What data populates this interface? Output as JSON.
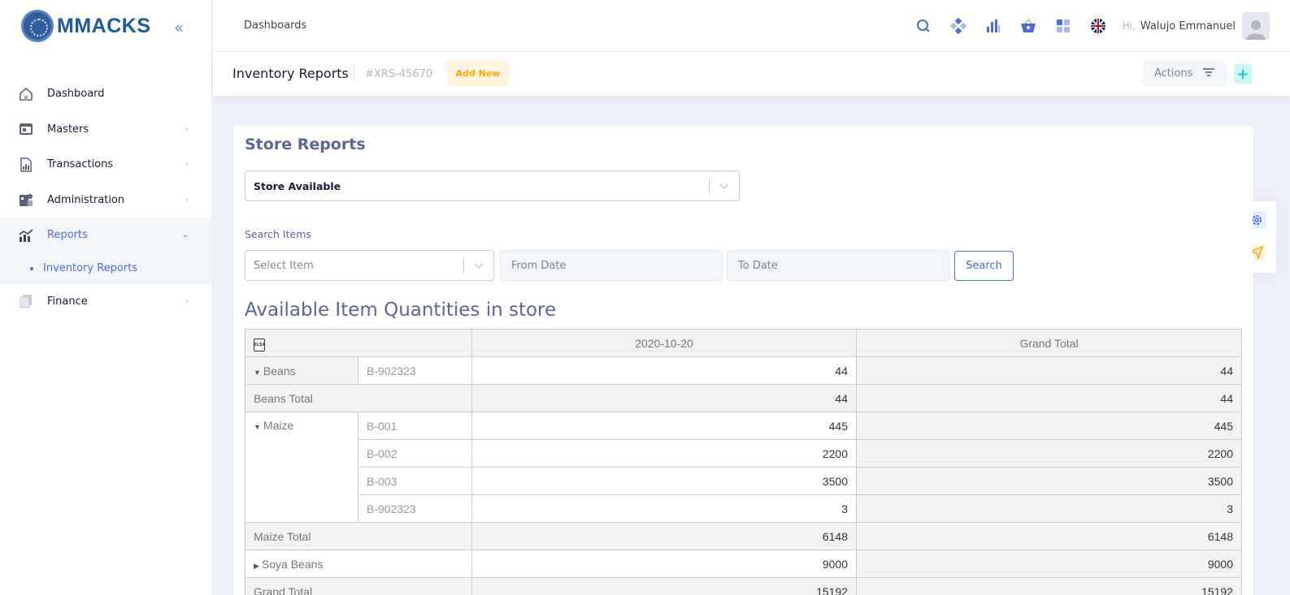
{
  "brand": {
    "name": "MMACKS",
    "collapse_icon": "«"
  },
  "sidebar": {
    "items": [
      {
        "label": "Dashboard",
        "icon": "home-icon"
      },
      {
        "label": "Masters",
        "icon": "window-icon"
      },
      {
        "label": "Transactions",
        "icon": "report-icon"
      },
      {
        "label": "Administration",
        "icon": "admin-icon"
      },
      {
        "label": "Reports",
        "icon": "chart-icon"
      },
      {
        "label": "Finance",
        "icon": "files-icon"
      }
    ],
    "sub_items": [
      {
        "label": "Inventory Reports"
      }
    ]
  },
  "header": {
    "breadcrumb": "Dashboards",
    "greeting": "Hi,",
    "user_name": "Walujo Emmanuel",
    "icons": [
      "search-icon",
      "diamond-icon",
      "bar-chart-icon",
      "cart-icon",
      "grid-icon",
      "uk-flag-icon"
    ]
  },
  "subheader": {
    "title": "Inventory Reports",
    "code": "#XRS-45670",
    "add_new": "Add New",
    "actions": "Actions",
    "plus": "+"
  },
  "card": {
    "title": "Store Reports",
    "store_select": "Store Available",
    "search_label": "Search Items",
    "item_placeholder": "Select Item",
    "from_date_placeholder": "From Date",
    "to_date_placeholder": "To Date",
    "search_button": "Search",
    "section_title": "Available Item Quantities in store"
  },
  "pivot": {
    "export_icon": "XLSX",
    "col_date": "2020-10-20",
    "col_total": "Grand Total",
    "beans": {
      "label": "Beans",
      "code": "B-902323",
      "v1": "44",
      "v2": "44"
    },
    "beans_total": {
      "label": "Beans Total",
      "v1": "44",
      "v2": "44"
    },
    "maize": {
      "label": "Maize",
      "rows": [
        {
          "code": "B-001",
          "v1": "445",
          "v2": "445"
        },
        {
          "code": "B-002",
          "v1": "2200",
          "v2": "2200"
        },
        {
          "code": "B-003",
          "v1": "3500",
          "v2": "3500"
        },
        {
          "code": "B-902323",
          "v1": "3",
          "v2": "3"
        }
      ]
    },
    "maize_total": {
      "label": "Maize Total",
      "v1": "6148",
      "v2": "6148"
    },
    "soya": {
      "label": "Soya Beans",
      "v1": "9000",
      "v2": "9000"
    },
    "grand_total": {
      "label": "Grand Total",
      "v1": "15192",
      "v2": "15192"
    }
  }
}
